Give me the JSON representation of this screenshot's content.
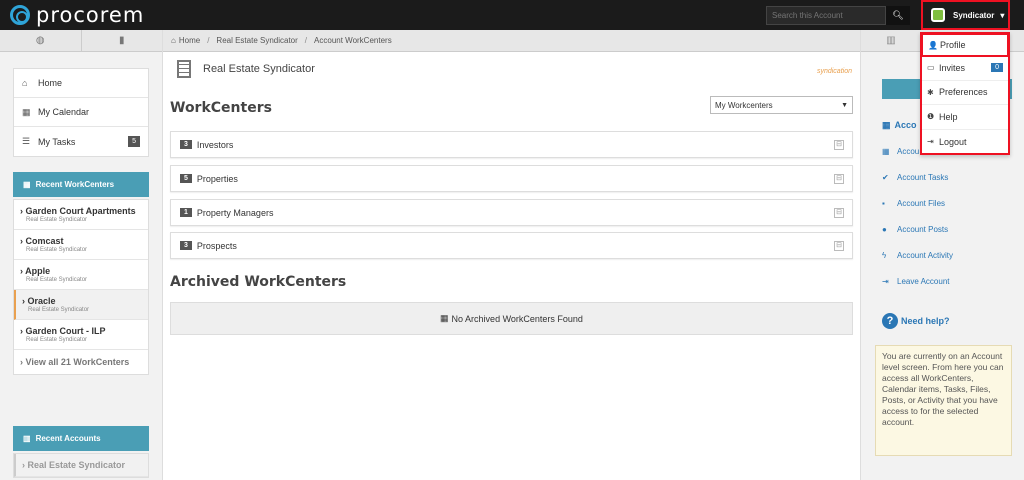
{
  "topbar": {
    "logo_text": "procorem",
    "search_placeholder": "Search this Account",
    "search_icon": "search-icon",
    "user_name": "Syndicator",
    "user_caret": "▾"
  },
  "user_menu": {
    "items": [
      {
        "icon": "user-icon",
        "glyph": "👤",
        "label": "Profile"
      },
      {
        "icon": "inbox-icon",
        "glyph": "▭",
        "label": "Invites",
        "badge": "0"
      },
      {
        "icon": "gear-icon",
        "glyph": "✱",
        "label": "Preferences"
      },
      {
        "icon": "info-icon",
        "glyph": "❶",
        "label": "Help"
      },
      {
        "icon": "logout-icon",
        "glyph": "⇥",
        "label": "Logout"
      }
    ]
  },
  "left_sidebar": {
    "tabs": [
      {
        "icon": "globe-icon",
        "glyph": "◍"
      },
      {
        "icon": "bookmark-icon",
        "glyph": "▮"
      }
    ],
    "nav": [
      {
        "icon": "home-icon",
        "glyph": "⌂",
        "label": "Home"
      },
      {
        "icon": "calendar-icon",
        "glyph": "▦",
        "label": "My Calendar"
      },
      {
        "icon": "tasks-icon",
        "glyph": "☰",
        "label": "My Tasks",
        "badge": "5"
      }
    ],
    "recent_workcenters_title": "Recent WorkCenters",
    "recent_workcenters": [
      {
        "name": "Garden Court Apartments",
        "sub": "Real Estate Syndicator"
      },
      {
        "name": "Comcast",
        "sub": "Real Estate Syndicator"
      },
      {
        "name": "Apple",
        "sub": "Real Estate Syndicator"
      },
      {
        "name": "Oracle",
        "sub": "Real Estate Syndicator"
      },
      {
        "name": "Garden Court - ILP",
        "sub": "Real Estate Syndicator"
      }
    ],
    "view_all": "View all 21 WorkCenters",
    "recent_accounts_title": "Recent Accounts",
    "recent_accounts": [
      {
        "name": "Real Estate Syndicator"
      }
    ]
  },
  "breadcrumb": {
    "items": [
      "Home",
      "Real Estate Syndicator",
      "Account WorkCenters"
    ],
    "separator": "/"
  },
  "main": {
    "account_name": "Real Estate Syndicator",
    "brand_logo_text": "syndication",
    "workcenters_title": "WorkCenters",
    "filter_select": "My Workcenters",
    "workcenters": [
      {
        "count": "3",
        "label": "Investors"
      },
      {
        "count": "5",
        "label": "Properties"
      },
      {
        "count": "1",
        "label": "Property Managers"
      },
      {
        "count": "3",
        "label": "Prospects"
      }
    ],
    "archived_title": "Archived WorkCenters",
    "archived_empty": "No Archived WorkCenters Found"
  },
  "right_sidebar": {
    "create_button": "Cr",
    "account_section_title": "Acco",
    "links": [
      {
        "icon": "calendar-icon",
        "glyph": "▦",
        "label": "Accou"
      },
      {
        "icon": "check-icon",
        "glyph": "✔",
        "label": "Account Tasks"
      },
      {
        "icon": "file-icon",
        "glyph": "▪",
        "label": "Account Files"
      },
      {
        "icon": "comments-icon",
        "glyph": "●",
        "label": "Account Posts"
      },
      {
        "icon": "bolt-icon",
        "glyph": "ϟ",
        "label": "Account Activity"
      },
      {
        "icon": "leave-icon",
        "glyph": "⇥",
        "label": "Leave Account"
      }
    ],
    "need_help": "Need help?",
    "info_text": "You are currently on an Account level screen. From here you can access all WorkCenters, Calendar items, Tasks, Files, Posts, or Activity that you have access to for the selected account."
  }
}
